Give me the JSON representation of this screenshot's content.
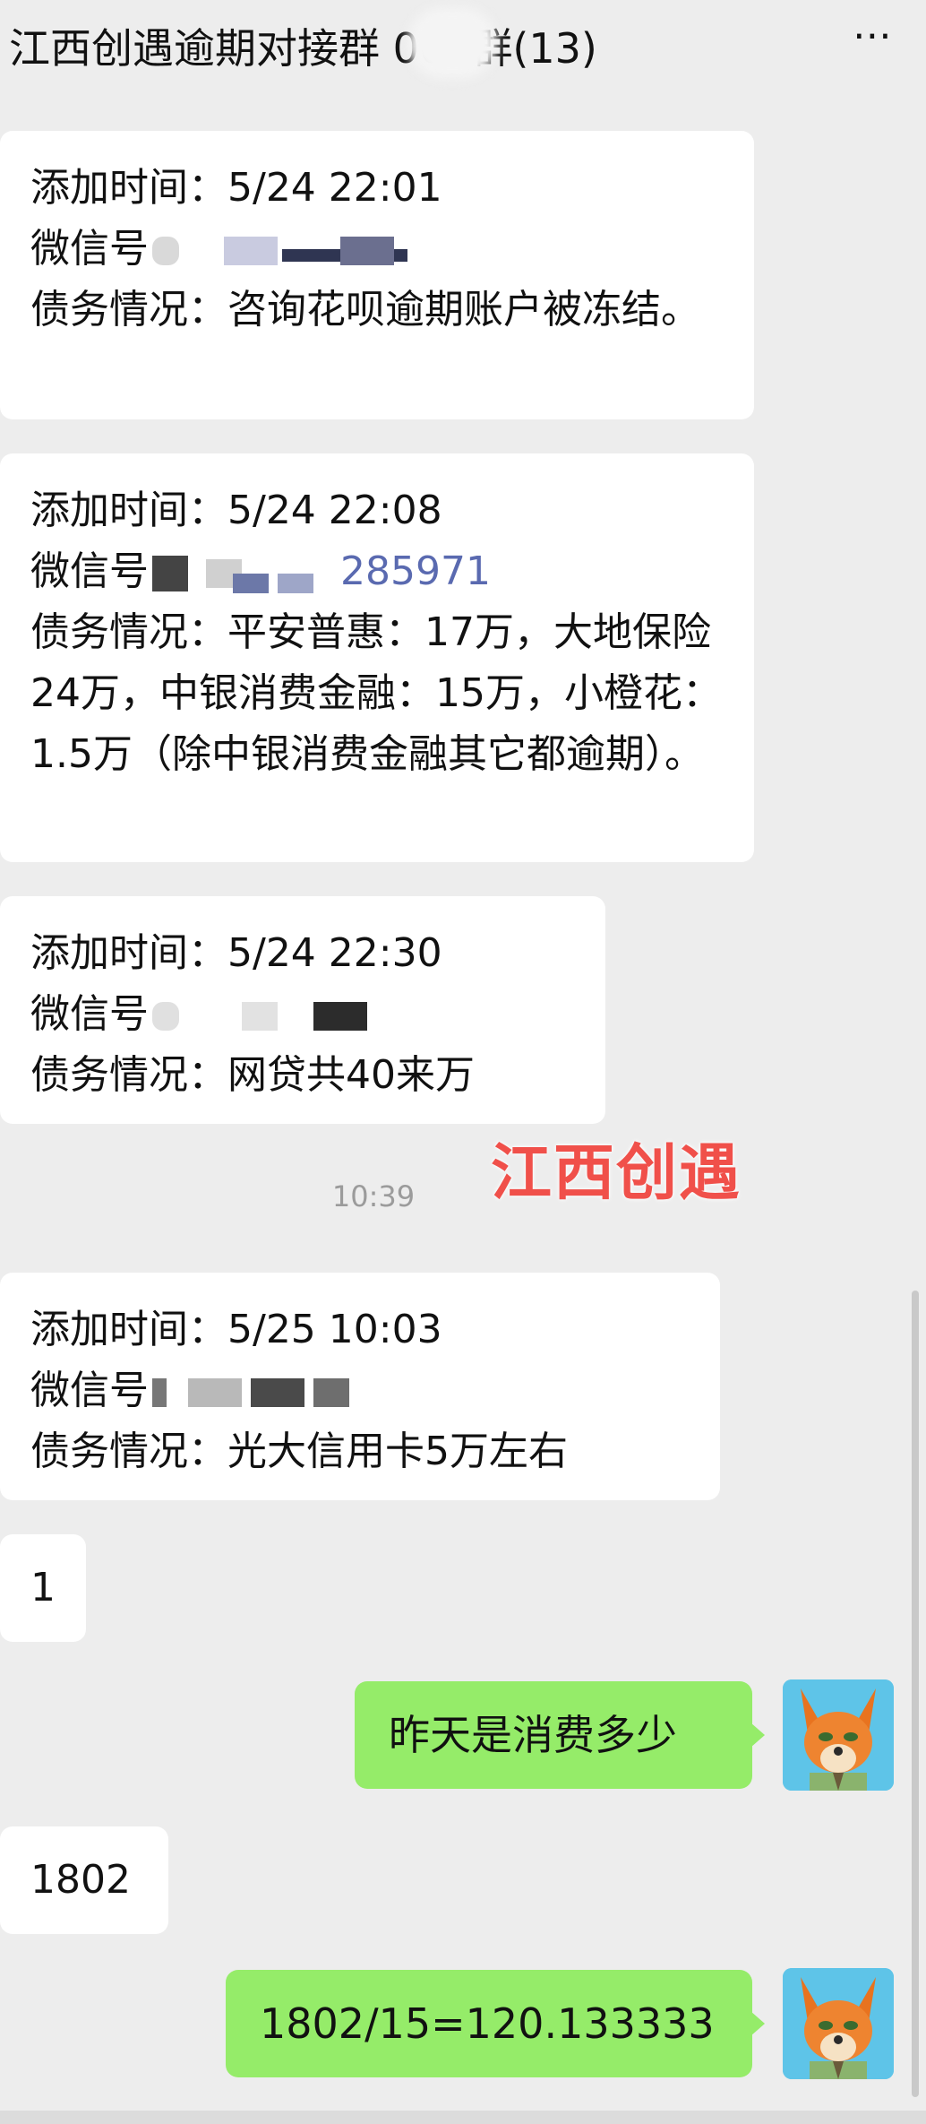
{
  "header": {
    "title": "江西创遇逾期对接群    002群(13)",
    "more_icon": "more-dots-icon"
  },
  "messages": [
    {
      "lines": [
        "添加时间：5/24 22:01",
        "微信号",
        "债务情况：咨询花呗逾期账户被冻结。"
      ]
    },
    {
      "lines": [
        "添加时间：5/24 22:08",
        "微信号",
        "285971",
        "债务情况：平安普惠：17万，大地保险24万，中银消费金融：15万，小橙花：1.5万（除中银消费金融其它都逾期）。"
      ]
    },
    {
      "lines": [
        "添加时间：5/24 22:30",
        "微信号",
        "债务情况：网贷共40来万"
      ]
    },
    {
      "lines": [
        "添加时间：5/25 10:03",
        "微信号",
        "债务情况：光大信用卡5万左右"
      ]
    }
  ],
  "timestamp": "10:39",
  "watermark": "江西创遇",
  "replies": {
    "incoming_1": "1",
    "outgoing_1": "昨天是消费多少",
    "incoming_2": "1802",
    "outgoing_2": "1802/15=120.133333"
  },
  "colors": {
    "background": "#ededed",
    "incoming_bubble": "#ffffff",
    "outgoing_bubble": "#95ec69",
    "watermark": "#f0504a"
  }
}
